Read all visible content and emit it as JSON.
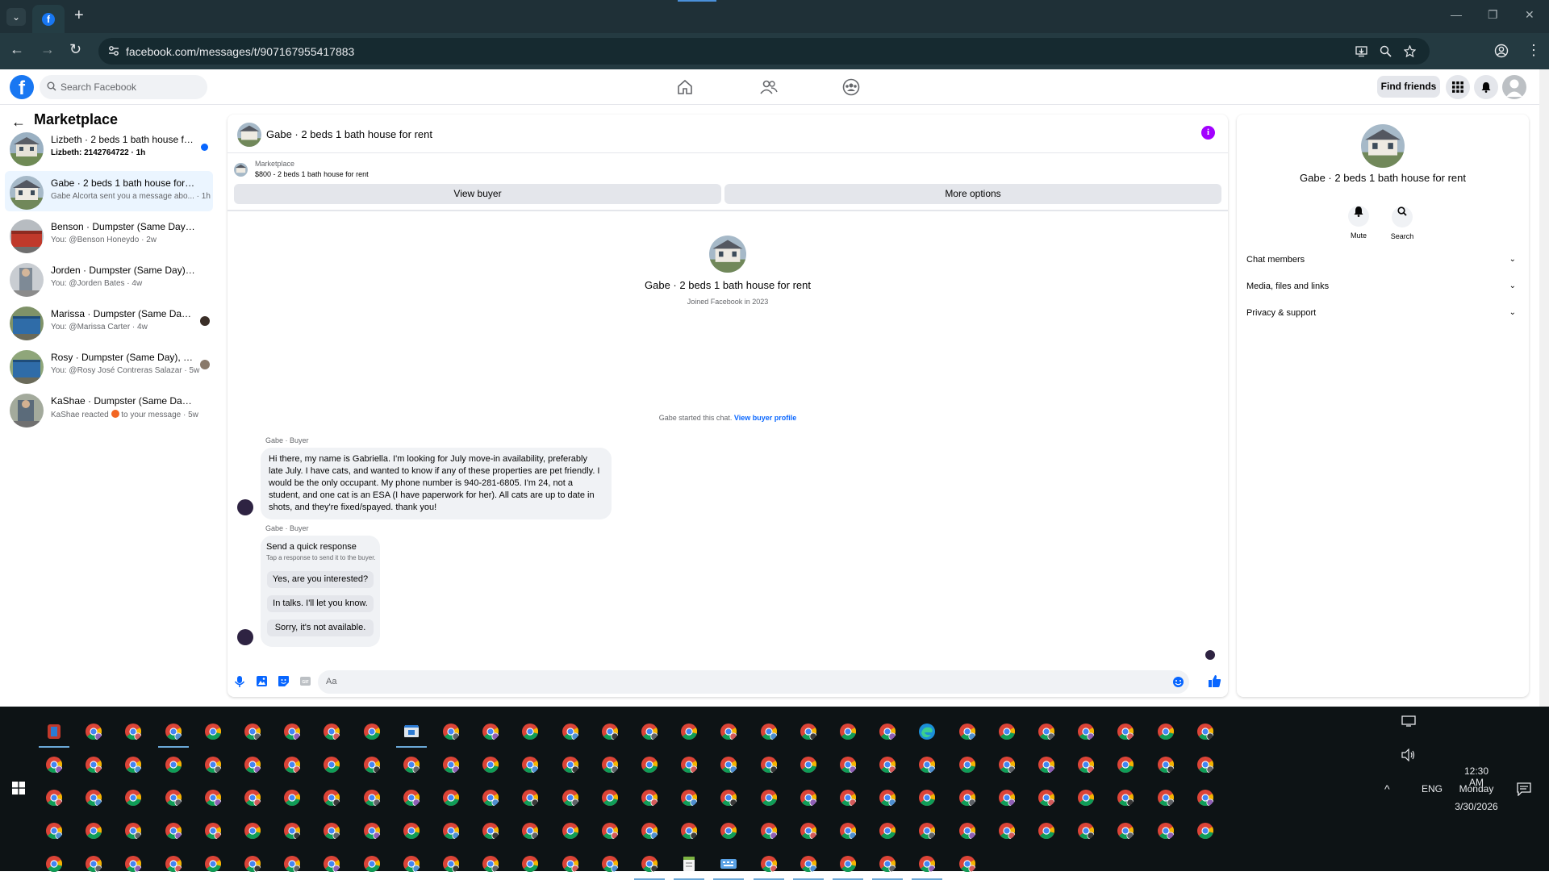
{
  "browser": {
    "url": "facebook.com/messages/t/907167955417883"
  },
  "fb_header": {
    "search_placeholder": "Search Facebook",
    "find_friends": "Find friends"
  },
  "inbox": {
    "title": "Marketplace",
    "conversations": [
      {
        "name": "Lizbeth · 2 beds 1 bath house for rent",
        "preview": "Lizbeth: 2142764722 · 1h",
        "unread": true
      },
      {
        "name": "Gabe · 2 beds 1 bath house for rent",
        "preview": "Gabe Alcorta sent you a message abo... · 1h",
        "selected": true
      },
      {
        "name": "Benson · Dumpster (Same Day), Re...",
        "preview": "You: @Benson Honeydo · 2w"
      },
      {
        "name": "Jorden · Dumpster (Same Day), Re...",
        "preview": "You: @Jorden Bates · 4w"
      },
      {
        "name": "Marissa · Dumpster (Same Day),...",
        "preview": "You: @Marissa Carter · 4w"
      },
      {
        "name": "Rosy · Dumpster (Same Day), Re...",
        "preview": "You: @Rosy José Contreras Salazar · 5w"
      },
      {
        "name": "KaShae · Dumpster (Same Day), Re...",
        "preview_before": "KaShae reacted",
        "preview_after": "to your message · 5w"
      }
    ]
  },
  "chat": {
    "title": "Gabe · 2 beds 1 bath house for rent",
    "marketplace_label": "Marketplace",
    "listing": "$800 - 2 beds 1 bath house for rent",
    "view_buyer": "View buyer",
    "more_options": "More options",
    "profile_name": "Gabe · 2 beds 1 bath house for rent",
    "joined": "Joined Facebook in 2023",
    "started_text": "Gabe started this chat.",
    "view_buyer_profile": "View buyer profile",
    "sender_label": "Gabe · Buyer",
    "message": "Hi there, my name is Gabriella. I'm looking for July move-in availability, preferably late July. I have cats, and wanted to know if any of these properties are pet friendly. I would be the only occupant. My phone number is 940-281-6805. I'm 24, not a student, and one cat is an ESA (I have paperwork for her). All cats are up to date in shots, and they're fixed/spayed. thank you!",
    "quick_title": "Send a quick response",
    "quick_sub": "Tap a response to send it to the buyer.",
    "quick_responses": [
      "Yes, are you interested?",
      "In talks. I'll let you know.",
      "Sorry, it's not available."
    ],
    "composer_placeholder": "Aa"
  },
  "details": {
    "name": "Gabe · 2 beds 1 bath house for rent",
    "mute": "Mute",
    "search": "Search",
    "sections": [
      "Chat members",
      "Media, files and links",
      "Privacy & support"
    ]
  },
  "taskbar": {
    "language": "ENG",
    "time": "12:30 AM",
    "day": "Monday",
    "date": "3/30/2026"
  },
  "colors": {
    "facebook_blue": "#1877f2",
    "messenger_blue": "#0866ff",
    "info_purple": "#a200ff",
    "chrome_frame": "#1f3037"
  }
}
